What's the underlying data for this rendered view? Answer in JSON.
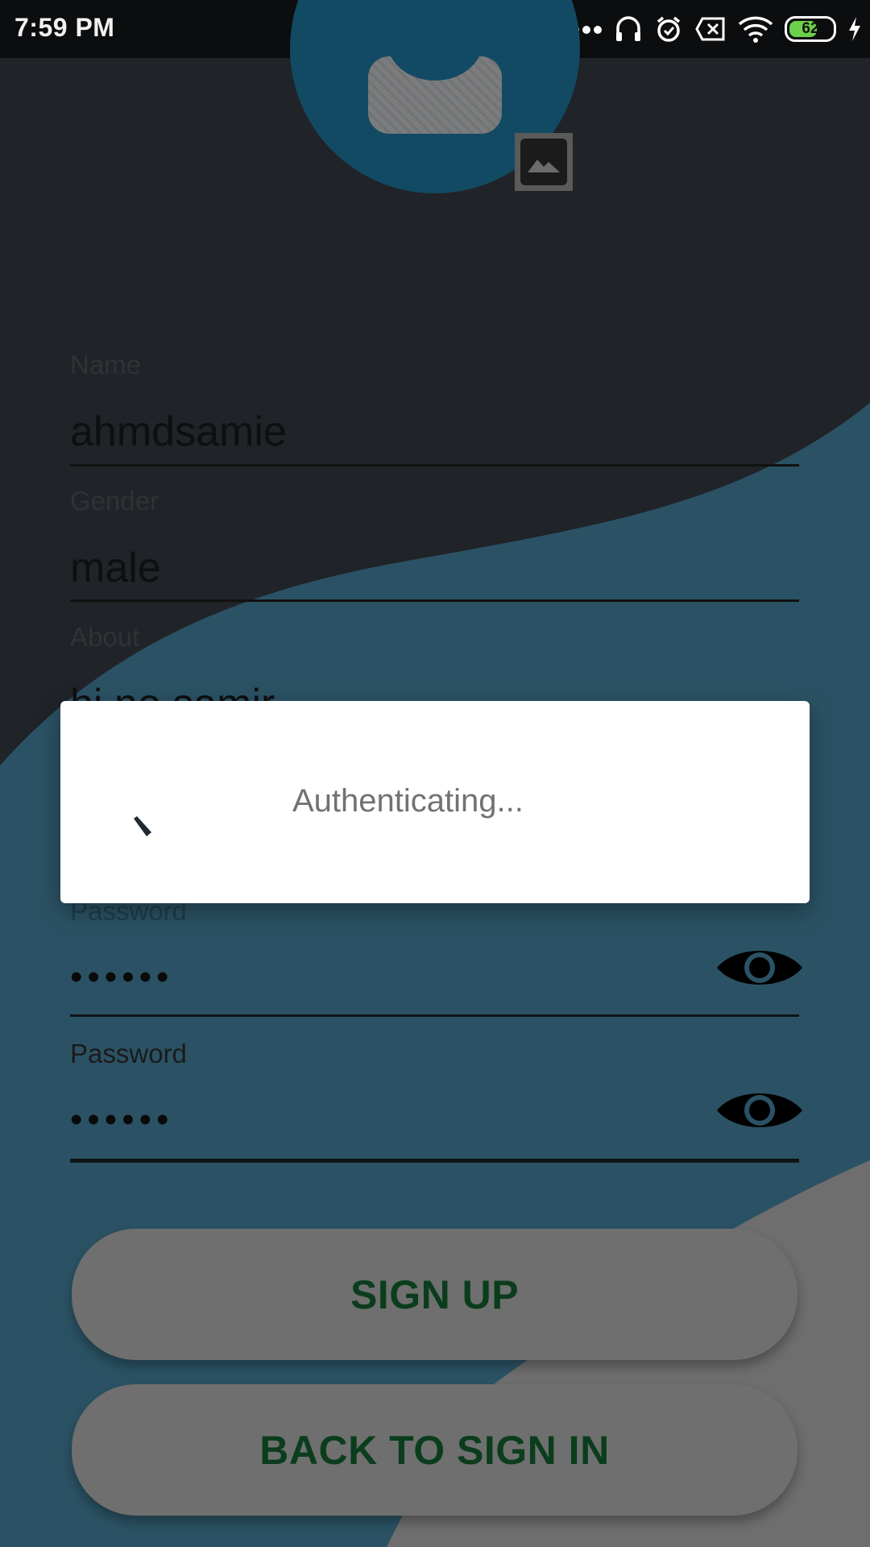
{
  "status_bar": {
    "time": "7:59 PM",
    "battery_level": "62",
    "icons": [
      "more-dots-icon",
      "headphones-icon",
      "alarm-icon",
      "sim-x-icon",
      "wifi-icon",
      "battery-icon",
      "charging-bolt-icon"
    ]
  },
  "profile": {
    "avatar_icon": "person-placeholder-icon",
    "image_picker_icon": "image-icon"
  },
  "form": {
    "name": {
      "label": "Name",
      "value": "ahmdsamie"
    },
    "gender": {
      "label": "Gender",
      "value": "male"
    },
    "about": {
      "label": "About",
      "value": "hi no samir"
    },
    "password": {
      "label": "Password",
      "value": "••••••",
      "toggle_icon": "eye-icon"
    },
    "confirm_password": {
      "label": "Password",
      "value": "••••••",
      "toggle_icon": "eye-icon"
    }
  },
  "buttons": {
    "sign_up": "SIGN UP",
    "back_to_sign_in": "BACK TO SIGN IN"
  },
  "dialog": {
    "message": "Authenticating..."
  },
  "colors": {
    "dark_bg": "#1f2328",
    "teal_wave": "#2b5264",
    "gray_wave": "#6e6e6e",
    "avatar_blue": "#124a63",
    "button_text_green": "#0b3d1d"
  }
}
